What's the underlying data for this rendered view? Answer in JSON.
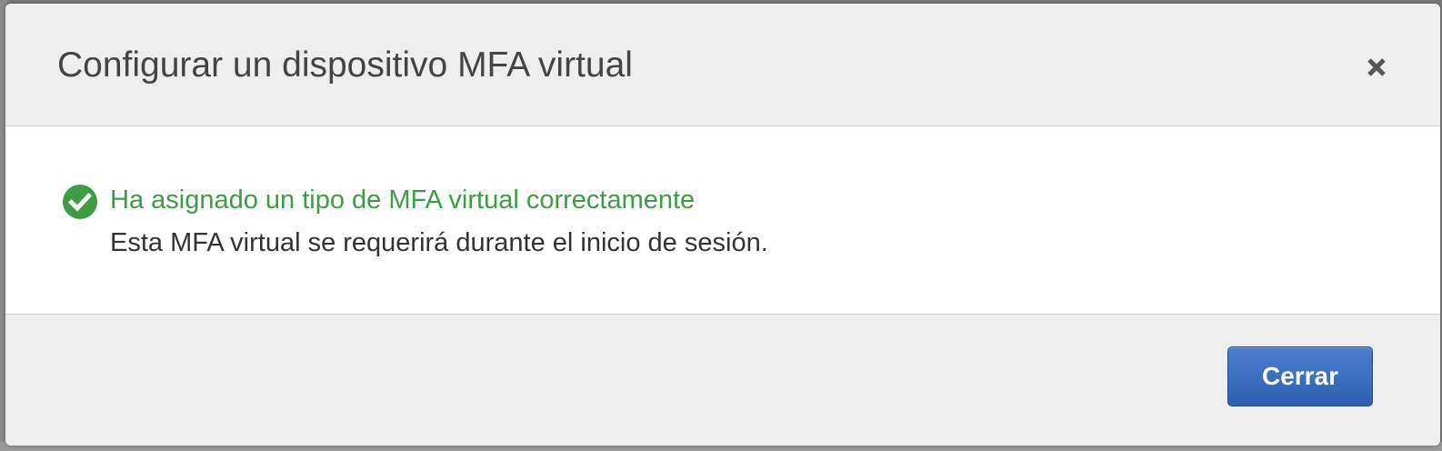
{
  "modal": {
    "title": "Configurar un dispositivo MFA virtual",
    "close_icon": "close-icon"
  },
  "message": {
    "icon": "check-circle-icon",
    "title": "Ha asignado un tipo de MFA virtual correctamente",
    "description": "Esta MFA virtual se requerirá durante el inicio de sesión."
  },
  "footer": {
    "close_label": "Cerrar"
  },
  "colors": {
    "success": "#3c9d43",
    "primary_button": "#3368b8",
    "header_bg": "#eeeeee",
    "title_text": "#444444"
  }
}
